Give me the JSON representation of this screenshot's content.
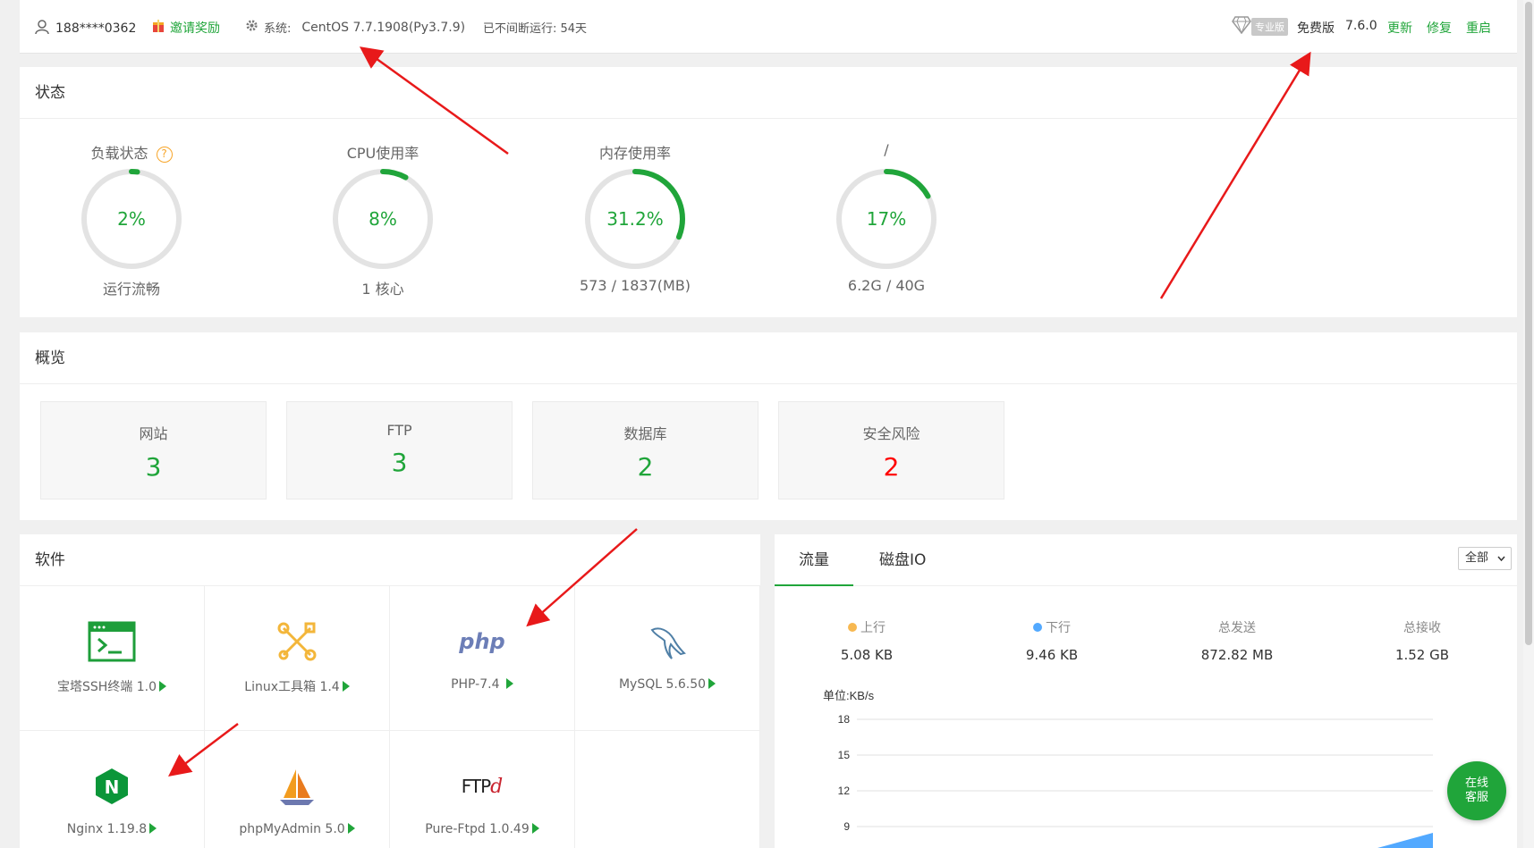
{
  "topbar": {
    "user": "188****0362",
    "invite": "邀请奖励",
    "system_label": "系统:",
    "system_value": "CentOS 7.7.1908(Py3.7.9)",
    "uptime": "已不间断运行: 54天",
    "pro_badge": "专业版",
    "edition": "免费版",
    "version": "7.6.0",
    "update": "更新",
    "repair": "修复",
    "restart": "重启"
  },
  "status": {
    "title": "状态",
    "gauges": [
      {
        "label": "负载状态",
        "value": "2%",
        "fraction": 0.02,
        "sub": "运行流畅"
      },
      {
        "label": "CPU使用率",
        "value": "8%",
        "fraction": 0.08,
        "sub": "1 核心"
      },
      {
        "label": "内存使用率",
        "value": "31.2%",
        "fraction": 0.312,
        "sub": "573 / 1837(MB)"
      },
      {
        "label": "/",
        "value": "17%",
        "fraction": 0.17,
        "sub": "6.2G / 40G"
      }
    ],
    "help_mark": "?"
  },
  "overview": {
    "title": "概览",
    "cards": [
      {
        "label": "网站",
        "value": "3",
        "color": "#20a53a"
      },
      {
        "label": "FTP",
        "value": "3",
        "color": "#20a53a"
      },
      {
        "label": "数据库",
        "value": "2",
        "color": "#20a53a"
      },
      {
        "label": "安全风险",
        "value": "2",
        "color": "#ff0000"
      }
    ]
  },
  "software": {
    "title": "软件",
    "items": [
      {
        "name": "宝塔SSH终端 1.0",
        "icon": "terminal-icon"
      },
      {
        "name": "Linux工具箱 1.4",
        "icon": "tools-icon"
      },
      {
        "name": "PHP-7.4",
        "icon": "php-icon"
      },
      {
        "name": "MySQL 5.6.50",
        "icon": "mysql-icon"
      },
      {
        "name": "Nginx 1.19.8",
        "icon": "nginx-icon"
      },
      {
        "name": "phpMyAdmin 5.0",
        "icon": "phpmyadmin-icon"
      },
      {
        "name": "Pure-Ftpd 1.0.49",
        "icon": "ftp-icon"
      }
    ],
    "php_logo": "php",
    "nginx_logo": "N",
    "ftp_logo_a": "FTP",
    "ftp_logo_b": "d"
  },
  "traffic": {
    "tabs": [
      "流量",
      "磁盘IO"
    ],
    "filter": "全部",
    "stats": [
      {
        "label": "上行",
        "value": "5.08 KB",
        "dot": "#f7b851"
      },
      {
        "label": "下行",
        "value": "9.46 KB",
        "dot": "#52a9ff"
      },
      {
        "label": "总发送",
        "value": "872.82 MB"
      },
      {
        "label": "总接收",
        "value": "1.52 GB"
      }
    ]
  },
  "chart_data": {
    "type": "area",
    "ylabel": "单位:KB/s",
    "yticks": [
      18,
      15,
      12,
      9
    ],
    "series": []
  },
  "service": {
    "line1": "在线",
    "line2": "客服"
  }
}
